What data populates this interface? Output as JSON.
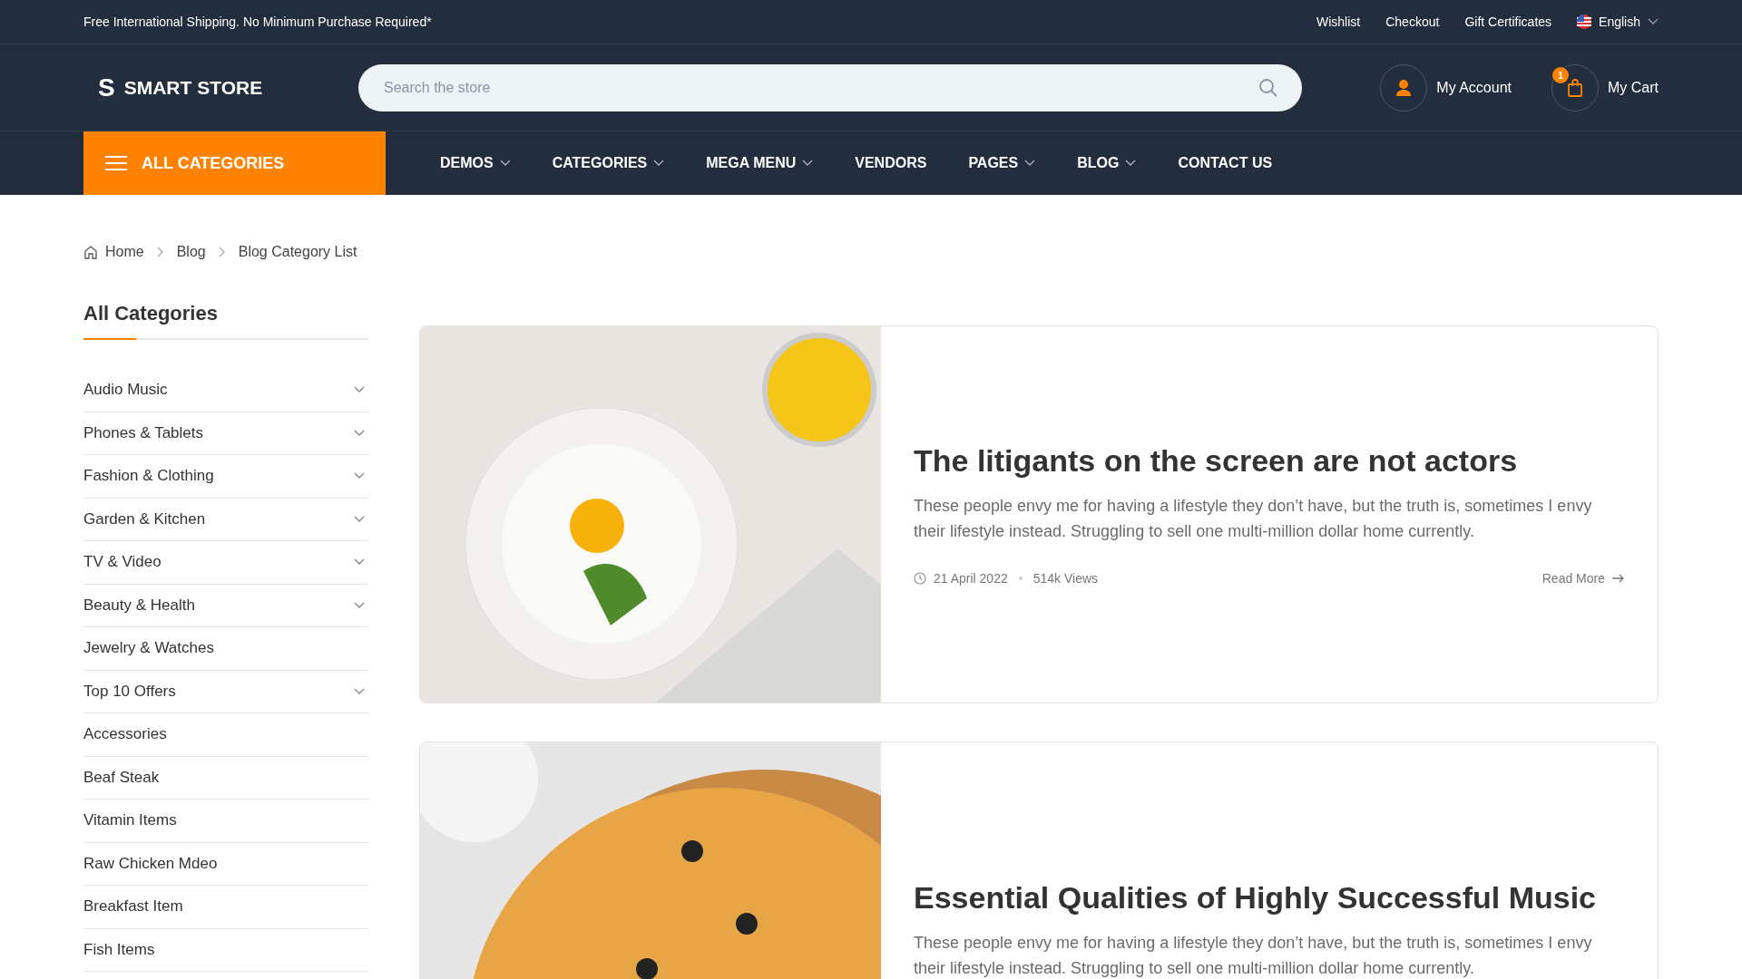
{
  "top_bar": {
    "notice": "Free International Shipping. No Minimum Purchase Required*",
    "links": [
      "Wishlist",
      "Checkout",
      "Gift Certificates"
    ],
    "language": "English"
  },
  "header": {
    "logo_mark": "S",
    "logo_text": "SMART STORE",
    "search": {
      "placeholder": "Search the store"
    },
    "account": "My Account",
    "cart": "My Cart",
    "cart_count": "1"
  },
  "nav": {
    "all_categories": "ALL CATEGORIES",
    "items": [
      {
        "label": "DEMOS",
        "has_dropdown": true
      },
      {
        "label": "CATEGORIES",
        "has_dropdown": true
      },
      {
        "label": "MEGA MENU",
        "has_dropdown": true
      },
      {
        "label": "VENDORS",
        "has_dropdown": false
      },
      {
        "label": "PAGES",
        "has_dropdown": true
      },
      {
        "label": "BLOG",
        "has_dropdown": true
      },
      {
        "label": "CONTACT US",
        "has_dropdown": false
      }
    ]
  },
  "breadcrumb": [
    "Home",
    "Blog",
    "Blog Category List"
  ],
  "sidebar": {
    "title": "All Categories",
    "items": [
      {
        "label": "Audio Music",
        "has_submenu": true
      },
      {
        "label": "Phones & Tablets",
        "has_submenu": true
      },
      {
        "label": "Fashion & Clothing",
        "has_submenu": true
      },
      {
        "label": "Garden & Kitchen",
        "has_submenu": true
      },
      {
        "label": "TV & Video",
        "has_submenu": true
      },
      {
        "label": "Beauty & Health",
        "has_submenu": true
      },
      {
        "label": "Jewelry & Watches",
        "has_submenu": false
      },
      {
        "label": "Top 10 Offers",
        "has_submenu": true
      },
      {
        "label": "Accessories",
        "has_submenu": false
      },
      {
        "label": "Beaf Steak",
        "has_submenu": false
      },
      {
        "label": "Vitamin Items",
        "has_submenu": false
      },
      {
        "label": "Raw Chicken Mdeo",
        "has_submenu": false
      },
      {
        "label": "Breakfast Item",
        "has_submenu": false
      },
      {
        "label": "Fish Items",
        "has_submenu": false
      }
    ]
  },
  "posts": [
    {
      "kind": "breakfast",
      "title": "The litigants on the screen are not actors",
      "excerpt": "These people envy me for having a lifestyle they don’t have, but the truth is, sometimes I envy their lifestyle instead. Struggling to sell one multi-million dollar home currently.",
      "date": "21 April 2022",
      "views": "514k Views",
      "read_more": "Read More"
    },
    {
      "kind": "pizza",
      "title": "Essential Qualities of Highly Successful Music",
      "excerpt": "These people envy me for having a lifestyle they don’t have, but the truth is, sometimes I envy their lifestyle instead. Struggling to sell one multi-million dollar home currently."
    }
  ]
}
